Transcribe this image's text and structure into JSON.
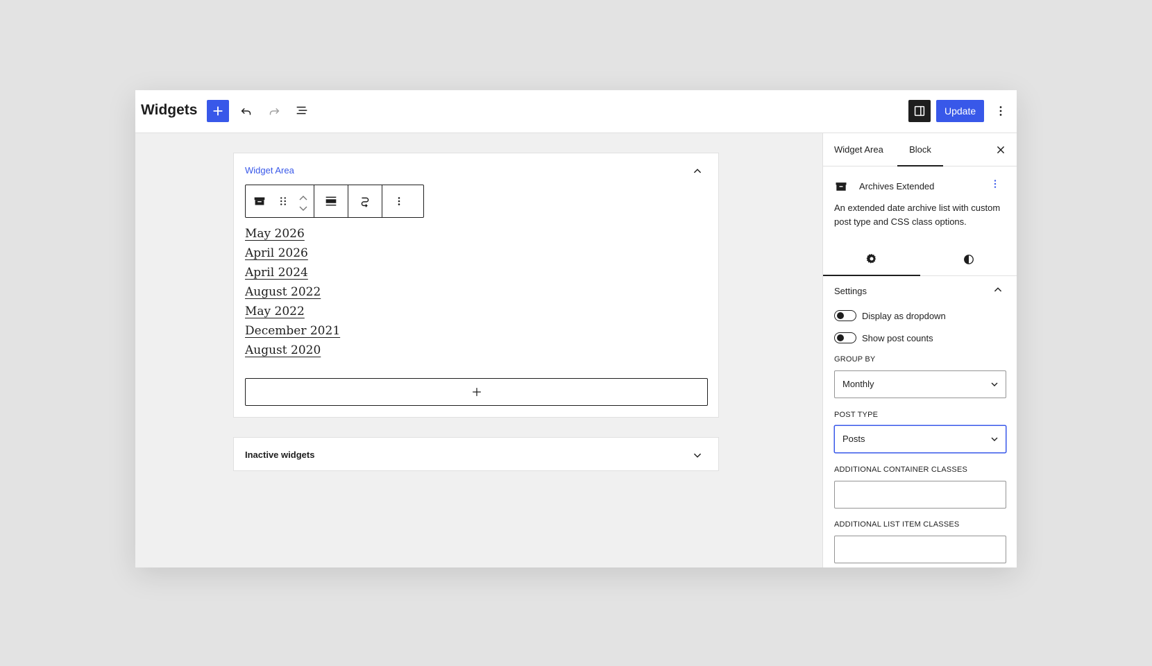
{
  "header": {
    "title": "Widgets",
    "update_label": "Update"
  },
  "widget_area": {
    "title": "Widget Area",
    "archives": [
      "May 2026",
      "April 2026",
      "April 2024",
      "August 2022",
      "May 2022",
      "December 2021",
      "August 2020"
    ]
  },
  "inactive": {
    "title": "Inactive widgets"
  },
  "sidebar": {
    "tabs": [
      "Widget Area",
      "Block"
    ],
    "block": {
      "title": "Archives Extended",
      "description": "An extended date archive list with custom post type and CSS class options."
    },
    "settings": {
      "title": "Settings",
      "toggles": [
        "Display as dropdown",
        "Show post counts"
      ],
      "group_by_label": "Group by",
      "group_by_value": "Monthly",
      "post_type_label": "Post type",
      "post_type_value": "Posts",
      "container_classes_label": "Additional container classes",
      "container_classes_value": "",
      "list_item_classes_label": "Additional list item classes",
      "list_item_classes_value": ""
    }
  },
  "colors": {
    "accent": "#3858e9",
    "dark": "#1e1e1e"
  }
}
